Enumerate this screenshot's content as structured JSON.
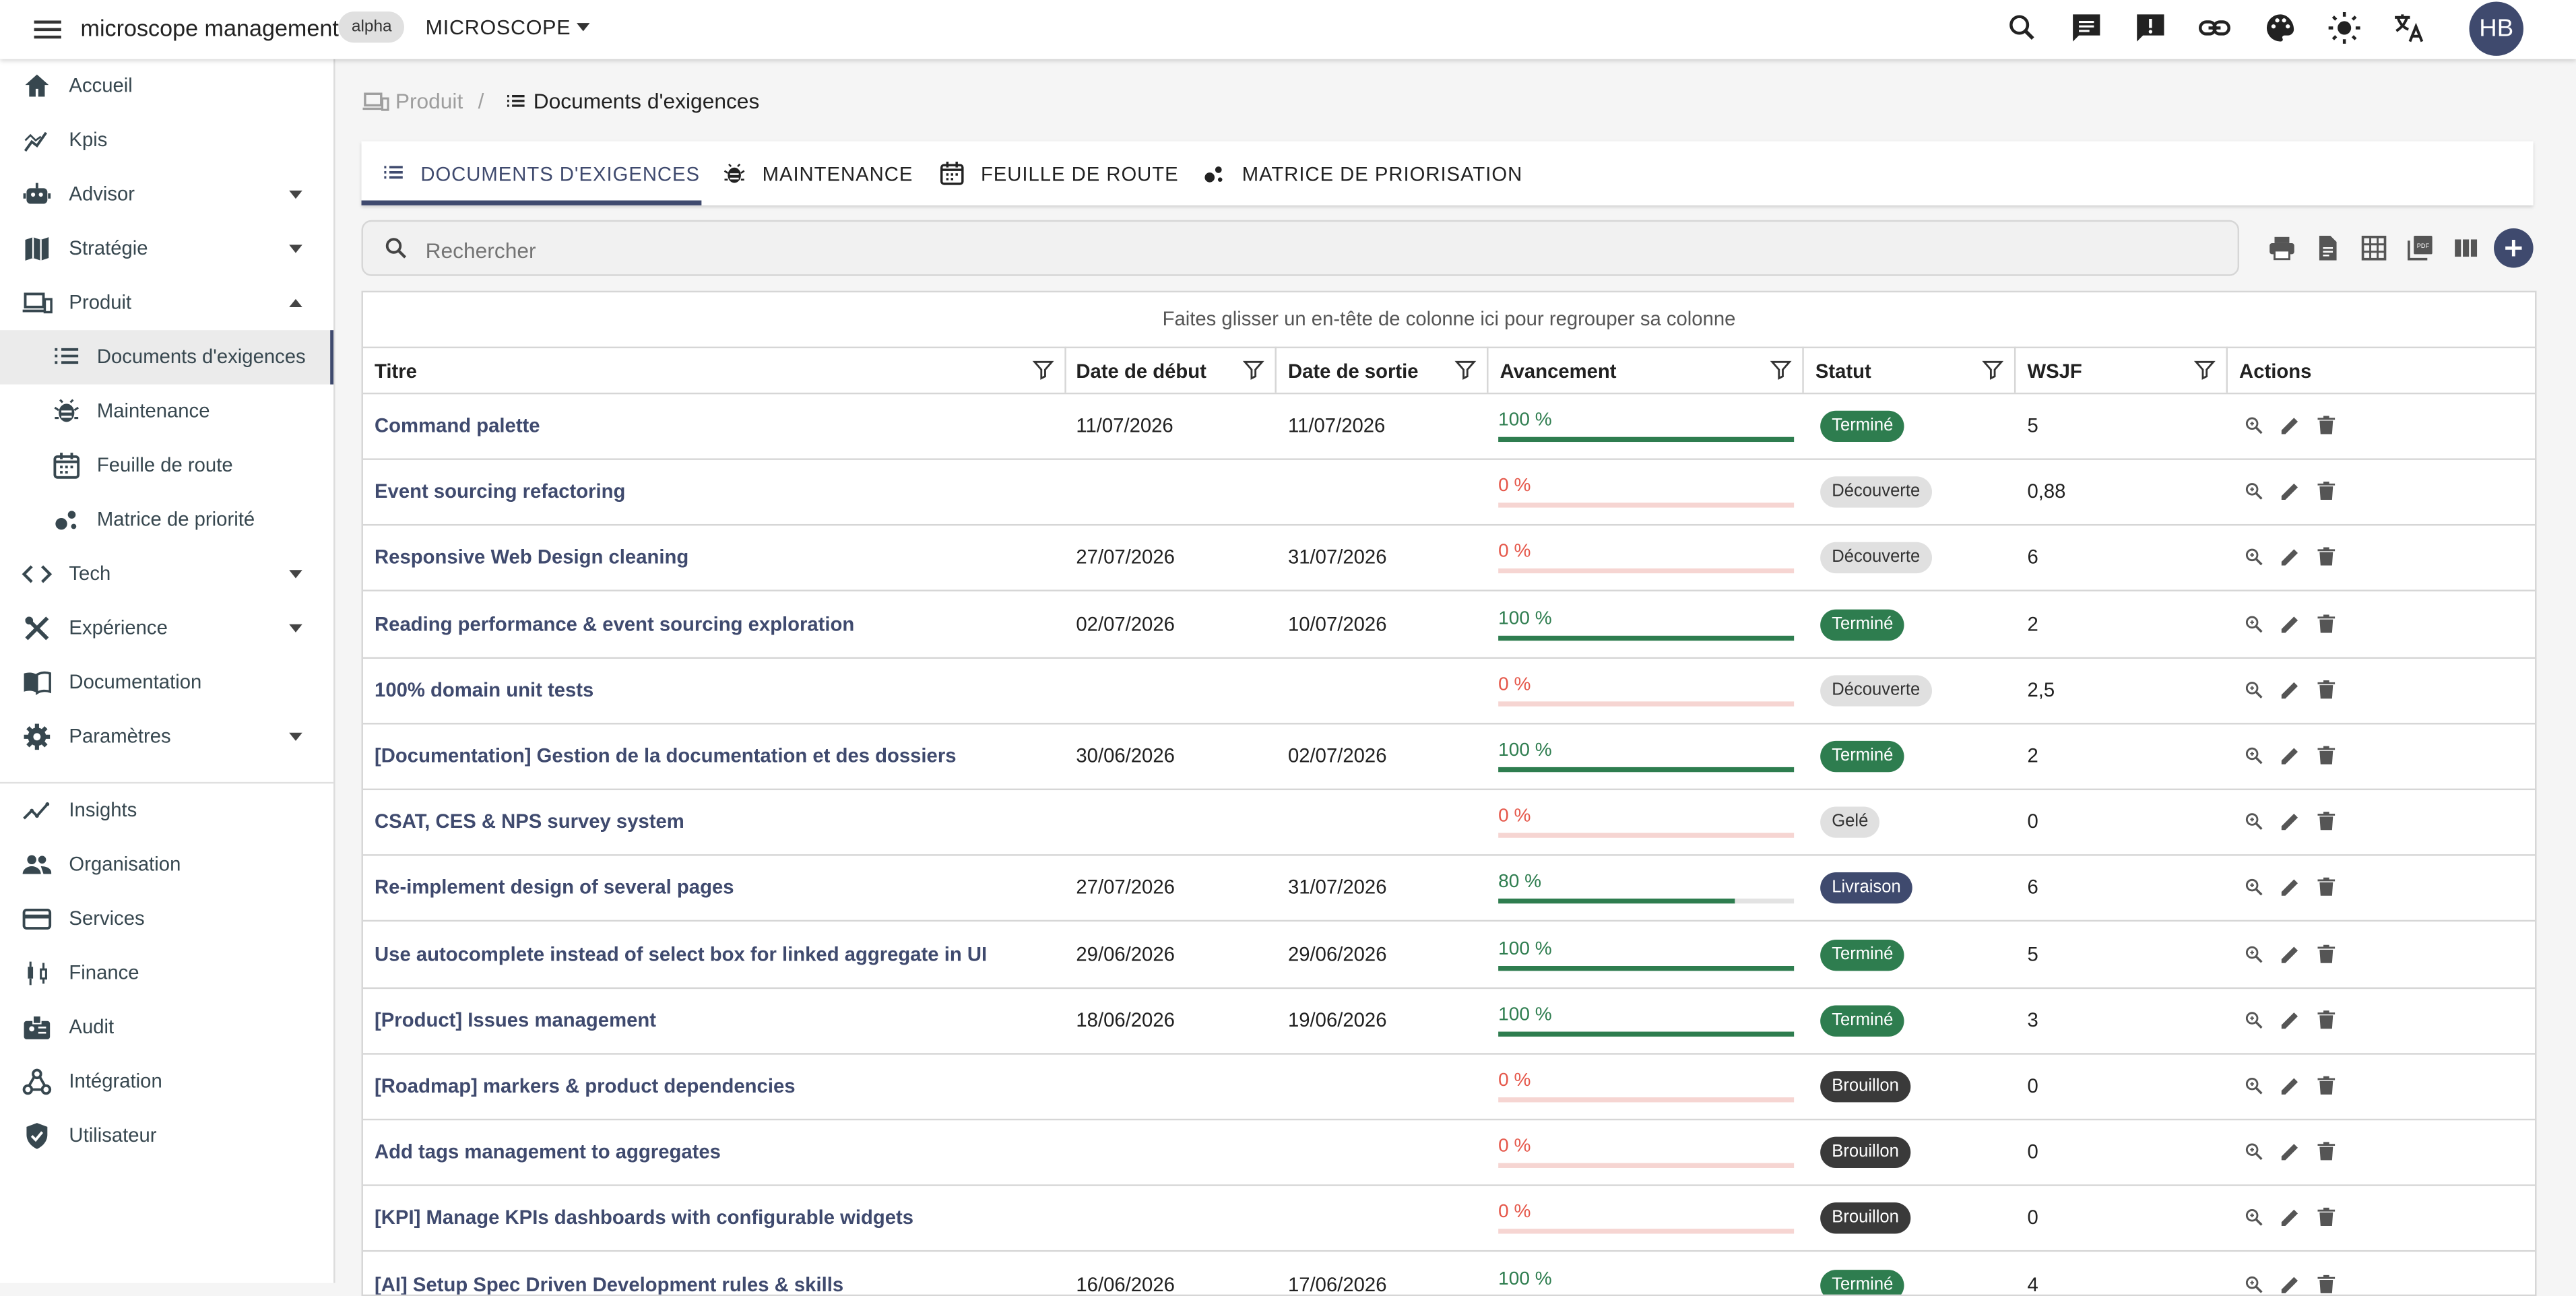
{
  "app": {
    "title": "microscope management",
    "badge": "alpha",
    "workspace": "MICROSCOPE",
    "avatar_initials": "HB"
  },
  "sidebar": {
    "items": [
      {
        "label": "Accueil",
        "icon": "home-icon"
      },
      {
        "label": "Kpis",
        "icon": "kpi-chart-icon"
      },
      {
        "label": "Advisor",
        "icon": "robot-icon",
        "expandable": true
      },
      {
        "label": "Stratégie",
        "icon": "map-icon",
        "expandable": true
      },
      {
        "label": "Produit",
        "icon": "devices-icon",
        "expandable": true,
        "expanded": true
      },
      {
        "label": "Documents d'exigences",
        "icon": "list-icon",
        "sub": true,
        "active": true
      },
      {
        "label": "Maintenance",
        "icon": "bug-icon",
        "sub": true
      },
      {
        "label": "Feuille de route",
        "icon": "calendar-icon",
        "sub": true
      },
      {
        "label": "Matrice de priorité",
        "icon": "bubble-chart-icon",
        "sub": true
      },
      {
        "label": "Tech",
        "icon": "code-icon",
        "expandable": true
      },
      {
        "label": "Expérience",
        "icon": "design-tools-icon",
        "expandable": true
      },
      {
        "label": "Documentation",
        "icon": "book-icon"
      },
      {
        "label": "Paramètres",
        "icon": "gear-icon",
        "expandable": true
      },
      {
        "label": "Insights",
        "icon": "insights-icon"
      },
      {
        "label": "Organisation",
        "icon": "people-icon"
      },
      {
        "label": "Services",
        "icon": "credit-card-icon"
      },
      {
        "label": "Finance",
        "icon": "candlestick-icon"
      },
      {
        "label": "Audit",
        "icon": "badge-icon"
      },
      {
        "label": "Intégration",
        "icon": "webhook-icon"
      },
      {
        "label": "Utilisateur",
        "icon": "shield-check-icon"
      }
    ]
  },
  "breadcrumb": {
    "parent": "Produit",
    "current": "Documents d'exigences"
  },
  "tabs": [
    {
      "label": "DOCUMENTS D'EXIGENCES",
      "icon": "list-icon",
      "active": true
    },
    {
      "label": "MAINTENANCE",
      "icon": "bug-icon"
    },
    {
      "label": "FEUILLE DE ROUTE",
      "icon": "calendar-icon"
    },
    {
      "label": "MATRICE DE PRIORISATION",
      "icon": "bubble-chart-icon"
    }
  ],
  "search": {
    "placeholder": "Rechercher",
    "value": ""
  },
  "grid": {
    "group_hint": "Faites glisser un en-tête de colonne ici pour regrouper sa colonne",
    "columns": [
      "Titre",
      "Date de début",
      "Date de sortie",
      "Avancement",
      "Statut",
      "WSJF",
      "Actions"
    ],
    "rows": [
      {
        "title": "Command palette",
        "start": "11/07/2026",
        "end": "11/07/2026",
        "progress": 100,
        "progress_label": "100 %",
        "status": "Terminé",
        "wsjf": "5"
      },
      {
        "title": "Event sourcing refactoring",
        "start": "",
        "end": "",
        "progress": 0,
        "progress_label": "0 %",
        "status": "Découverte",
        "wsjf": "0,88"
      },
      {
        "title": "Responsive Web Design cleaning",
        "start": "27/07/2026",
        "end": "31/07/2026",
        "progress": 0,
        "progress_label": "0 %",
        "status": "Découverte",
        "wsjf": "6"
      },
      {
        "title": "Reading performance & event sourcing exploration",
        "start": "02/07/2026",
        "end": "10/07/2026",
        "progress": 100,
        "progress_label": "100 %",
        "status": "Terminé",
        "wsjf": "2"
      },
      {
        "title": "100% domain unit tests",
        "start": "",
        "end": "",
        "progress": 0,
        "progress_label": "0 %",
        "status": "Découverte",
        "wsjf": "2,5"
      },
      {
        "title": "[Documentation] Gestion de la documentation et des dossiers",
        "start": "30/06/2026",
        "end": "02/07/2026",
        "progress": 100,
        "progress_label": "100 %",
        "status": "Terminé",
        "wsjf": "2"
      },
      {
        "title": "CSAT, CES & NPS survey system",
        "start": "",
        "end": "",
        "progress": 0,
        "progress_label": "0 %",
        "status": "Gelé",
        "wsjf": "0"
      },
      {
        "title": "Re-implement design of several pages",
        "start": "27/07/2026",
        "end": "31/07/2026",
        "progress": 80,
        "progress_label": "80 %",
        "status": "Livraison",
        "wsjf": "6"
      },
      {
        "title": "Use autocomplete instead of select box for linked aggregate in UI",
        "start": "29/06/2026",
        "end": "29/06/2026",
        "progress": 100,
        "progress_label": "100 %",
        "status": "Terminé",
        "wsjf": "5"
      },
      {
        "title": "[Product] Issues management",
        "start": "18/06/2026",
        "end": "19/06/2026",
        "progress": 100,
        "progress_label": "100 %",
        "status": "Terminé",
        "wsjf": "3"
      },
      {
        "title": "[Roadmap] markers & product dependencies",
        "start": "",
        "end": "",
        "progress": 0,
        "progress_label": "0 %",
        "status": "Brouillon",
        "wsjf": "0"
      },
      {
        "title": "Add tags management to aggregates",
        "start": "",
        "end": "",
        "progress": 0,
        "progress_label": "0 %",
        "status": "Brouillon",
        "wsjf": "0"
      },
      {
        "title": "[KPI] Manage KPIs dashboards with configurable widgets",
        "start": "",
        "end": "",
        "progress": 0,
        "progress_label": "0 %",
        "status": "Brouillon",
        "wsjf": "0"
      },
      {
        "title": "[AI] Setup Spec Driven Development rules & skills",
        "start": "16/06/2026",
        "end": "17/06/2026",
        "progress": 100,
        "progress_label": "100 %",
        "status": "Terminé",
        "wsjf": "4"
      }
    ]
  },
  "colors": {
    "primary": "#3f4a6e",
    "success": "#2e7d4f",
    "danger": "#e5574a",
    "danger_track": "#f6d5d2",
    "neutral_chip": "#e0e0e0",
    "dark_chip": "#3a3a3a"
  }
}
